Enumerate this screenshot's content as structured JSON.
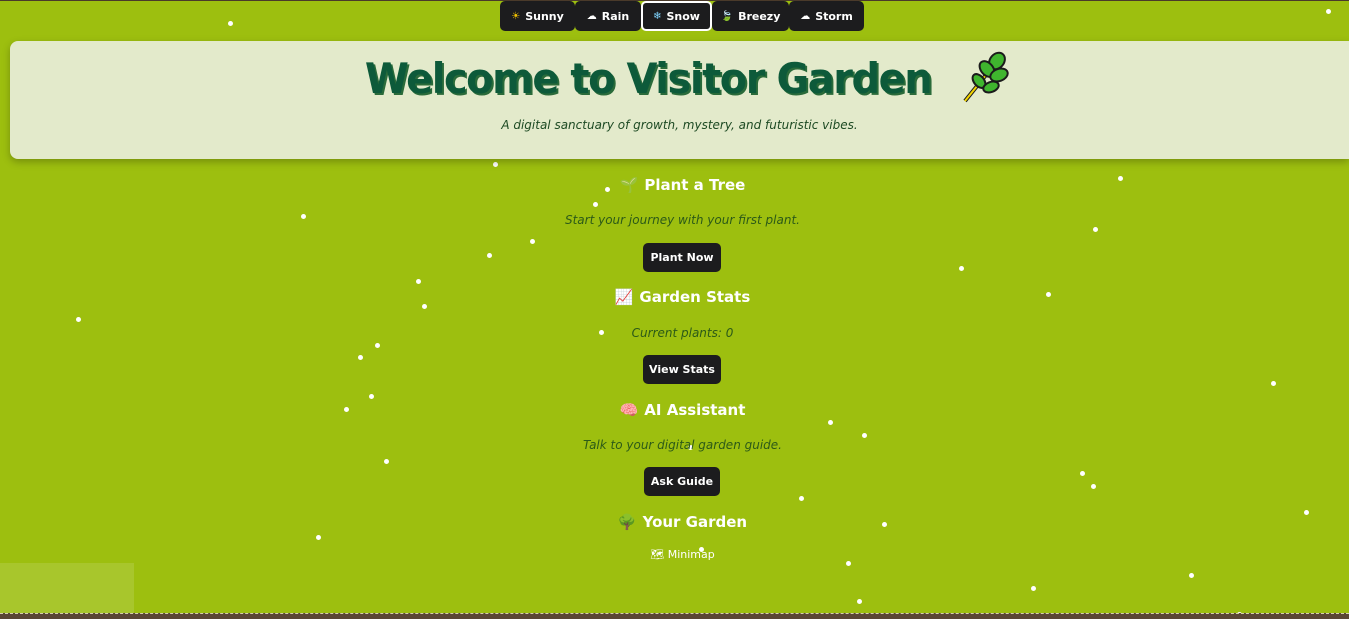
{
  "weather": {
    "buttons": [
      {
        "label": "Sunny",
        "icon": "☀"
      },
      {
        "label": "Rain",
        "icon": "☁"
      },
      {
        "label": "Snow",
        "icon": "❄"
      },
      {
        "label": "Breezy",
        "icon": "🍃"
      },
      {
        "label": "Storm",
        "icon": "☁"
      }
    ],
    "active": "Snow"
  },
  "header": {
    "title": "Welcome to Visitor Garden",
    "subtitle": "A digital sanctuary of growth, mystery, and futuristic vibes."
  },
  "sections": {
    "plant": {
      "icon": "🌱",
      "title": "Plant a Tree",
      "desc": "Start your journey with your first plant.",
      "button": "Plant Now"
    },
    "stats": {
      "icon": "📈",
      "title": "Garden Stats",
      "desc": "Current plants: 0",
      "button": "View Stats"
    },
    "assistant": {
      "icon": "🧠",
      "title": "AI Assistant",
      "desc": "Talk to your digital garden guide.",
      "button": "Ask Guide"
    },
    "garden": {
      "icon": "🌳",
      "title": "Your Garden"
    }
  },
  "minimap": {
    "icon": "🗺",
    "label": "Minimap"
  },
  "colors": {
    "background": "#9dbf0f",
    "header_bg": "#e3eacb",
    "title": "#0d5a3a",
    "button_bg": "#1c1c1e"
  }
}
